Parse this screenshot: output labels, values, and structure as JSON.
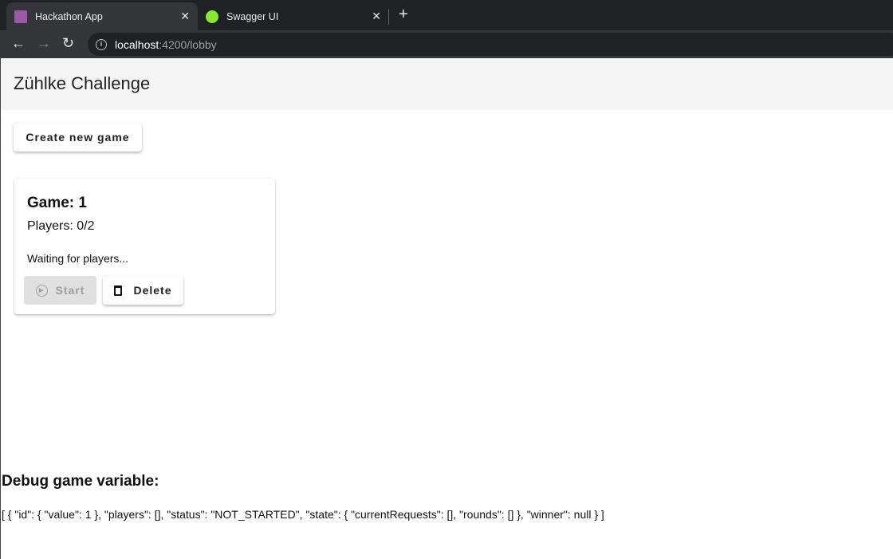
{
  "browser": {
    "tabs": [
      {
        "label": "Hackathon App",
        "active": true,
        "icon": "zuhlke-favicon"
      },
      {
        "label": "Swagger UI",
        "active": false,
        "icon": "swagger-favicon"
      }
    ],
    "url_host": "localhost",
    "url_path": ":4200/lobby"
  },
  "header": {
    "title": "Zühlke Challenge"
  },
  "create_button": "Create new game",
  "games": [
    {
      "title": "Game: 1",
      "players": "Players: 0/2",
      "status": "Waiting for players...",
      "start_label": "Start",
      "delete_label": "Delete"
    }
  ],
  "debug": {
    "heading": "Debug game variable:",
    "json": "[ { \"id\": { \"value\": 1 }, \"players\": [], \"status\": \"NOT_STARTED\", \"state\": { \"currentRequests\": [], \"rounds\": [] }, \"winner\": null } ]"
  }
}
